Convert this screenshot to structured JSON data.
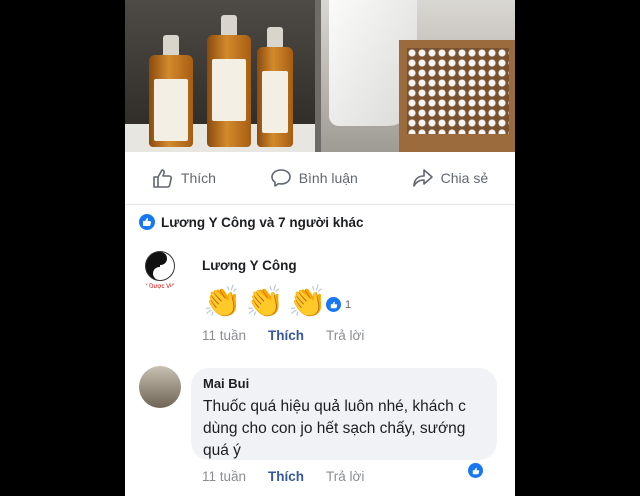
{
  "actions": {
    "like": "Thích",
    "comment": "Bình luận",
    "share": "Chia sẻ"
  },
  "reactions_summary": "Lương Y Công và 7 người khác",
  "comments": [
    {
      "author": "Lương Y Công",
      "content_icons": [
        "clapping-hands-icon",
        "clapping-hands-icon",
        "clapping-hands-icon"
      ],
      "reaction_count": "1",
      "time": "11 tuần",
      "like_label": "Thích",
      "reply_label": "Trả lời"
    },
    {
      "author": "Mai Bui",
      "text": "Thuốc quá hiệu quả luôn nhé,  khách c dùng cho con jo hết sạch chấy, sướng quá ý",
      "time": "11 tuần",
      "like_label": "Thích",
      "reply_label": "Trả lời"
    }
  ],
  "colors": {
    "facebook_blue": "#1877f2",
    "like_text": "#385898",
    "muted_text": "#8a8d91",
    "bubble_bg": "#f0f2f5"
  }
}
